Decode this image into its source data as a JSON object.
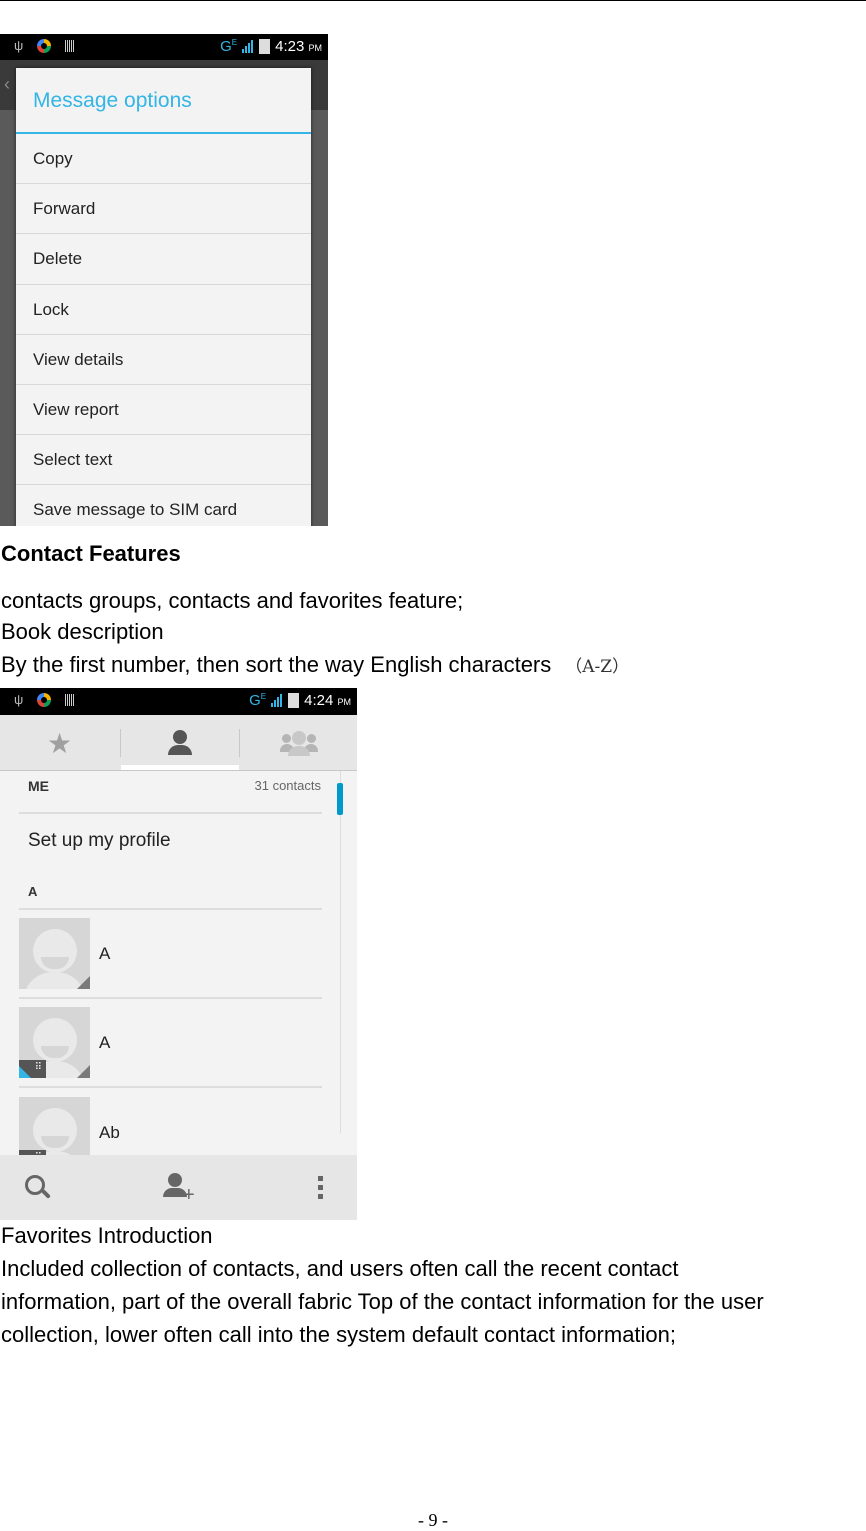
{
  "screenshot1": {
    "status_bar": {
      "network": "G",
      "network_sup": "E",
      "time": "4:23",
      "ampm": "PM"
    },
    "dialog": {
      "title": "Message options",
      "items": [
        "Copy",
        "Forward",
        "Delete",
        "Lock",
        "View details",
        "View report",
        "Select text",
        "Save message to SIM card"
      ]
    },
    "accent_color": "#33b5e5"
  },
  "text": {
    "heading": "Contact Features",
    "line1": "contacts groups, contacts and favorites feature;",
    "line2": "Book description",
    "line3": "By the first number, then sort the way English characters",
    "line3_suffix": "（A-Z）",
    "fav_title": "Favorites Introduction",
    "fav_line1": "Included collection of contacts, and users often call the recent contact",
    "fav_line2": "information, part of the overall fabric Top of the contact information for the user",
    "fav_line3": "collection, lower often call into the system default contact information;"
  },
  "screenshot2": {
    "status_bar": {
      "network": "G",
      "network_sup": "E",
      "time": "4:24",
      "ampm": "PM"
    },
    "tabs": [
      {
        "icon": "star-icon",
        "label": "Favorites",
        "selected": false
      },
      {
        "icon": "person-icon",
        "label": "All contacts",
        "selected": true
      },
      {
        "icon": "group-icon",
        "label": "Groups",
        "selected": false
      }
    ],
    "me_header": "ME",
    "contact_count": "31 contacts",
    "profile_label": "Set up my profile",
    "section_letter": "A",
    "contacts": [
      {
        "name": "A",
        "sim": false
      },
      {
        "name": "A",
        "sim": true
      },
      {
        "name": "Ab",
        "sim": true
      }
    ],
    "sim_glyph": "⠿",
    "bottom_bar": [
      "search-icon",
      "add-contact-icon",
      "overflow-menu-icon"
    ]
  },
  "page_number": "- 9 -"
}
